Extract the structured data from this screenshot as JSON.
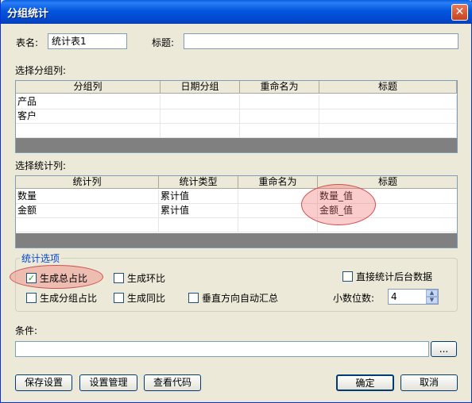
{
  "window": {
    "title": "分组统计",
    "close_label": "✕"
  },
  "form": {
    "table_name_label": "表名:",
    "table_name_value": "统计表1",
    "title_label": "标题:",
    "title_value": ""
  },
  "group_section": {
    "label": "选择分组列:",
    "columns": [
      "分组列",
      "日期分组",
      "重命名为",
      "标题"
    ],
    "rows": [
      [
        "产品",
        "",
        "",
        ""
      ],
      [
        "客户",
        "",
        "",
        ""
      ]
    ]
  },
  "stat_section": {
    "label": "选择统计列:",
    "columns": [
      "统计列",
      "统计类型",
      "重命名为",
      "标题"
    ],
    "rows": [
      [
        "数量",
        "累计值",
        "",
        "数量_值"
      ],
      [
        "金额",
        "累计值",
        "",
        "金额_值"
      ]
    ]
  },
  "options": {
    "legend": "统计选项",
    "gen_total_ratio": {
      "label": "生成总占比",
      "checked": true
    },
    "gen_ring_ratio": {
      "label": "生成环比",
      "checked": false
    },
    "direct_backend": {
      "label": "直接统计后台数据",
      "checked": false
    },
    "gen_group_ratio": {
      "label": "生成分组占比",
      "checked": false
    },
    "gen_yoy": {
      "label": "生成同比",
      "checked": false
    },
    "vertical_auto_sum": {
      "label": "垂直方向自动汇总",
      "checked": false
    },
    "decimal_label": "小数位数:",
    "decimal_value": "4"
  },
  "condition": {
    "label": "条件:",
    "value": "",
    "browse_label": "..."
  },
  "buttons": {
    "save_settings": "保存设置",
    "manage_settings": "设置管理",
    "view_code": "查看代码",
    "ok": "确定",
    "cancel": "取消"
  },
  "colors": {
    "title_bar": "#0456de",
    "dialog_bg": "#ece9d8",
    "highlight_ellipse": "#e86a6a"
  }
}
